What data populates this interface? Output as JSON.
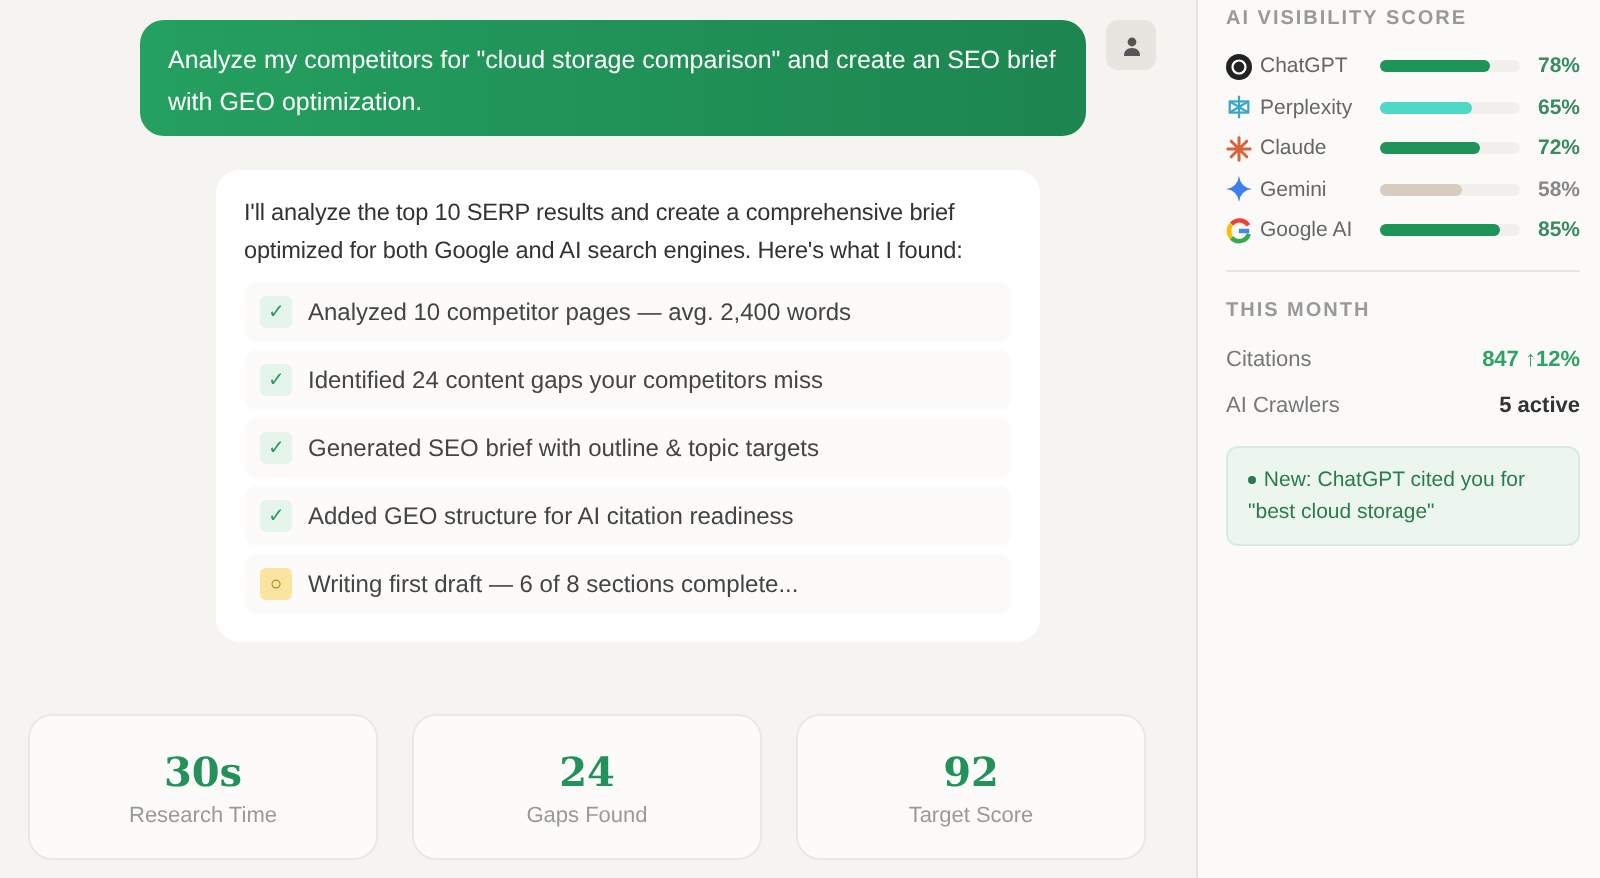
{
  "user_message": {
    "text": "Analyze my competitors for \"cloud storage comparison\" and create an SEO brief with GEO optimization."
  },
  "assistant_message": {
    "intro": "I'll analyze the top 10 SERP results and create a comprehensive brief optimized for both Google and AI search engines. Here's what I found:",
    "steps": [
      {
        "kind": "done",
        "icon": "✓",
        "text": "Analyzed 10 competitor pages — avg. 2,400 words"
      },
      {
        "kind": "done",
        "icon": "✓",
        "text": "Identified 24 content gaps your competitors miss"
      },
      {
        "kind": "done",
        "icon": "✓",
        "text": "Generated SEO brief with outline & topic targets"
      },
      {
        "kind": "done",
        "icon": "✓",
        "text": "Added GEO structure for AI citation readiness"
      },
      {
        "kind": "pending",
        "icon": "○",
        "text": "Writing first draft — 6 of 8 sections complete..."
      }
    ]
  },
  "stats": [
    {
      "value": "30s",
      "label": "Research Time"
    },
    {
      "value": "24",
      "label": "Gaps Found"
    },
    {
      "value": "92",
      "label": "Target Score"
    }
  ],
  "sidebar": {
    "visibility_title": "AI VISIBILITY SCORE",
    "engines": [
      {
        "kind": "chatgpt",
        "name": "ChatGPT",
        "level": 0.78,
        "reading": "78%",
        "color": "#1f9458"
      },
      {
        "kind": "perplexity",
        "name": "Perplexity",
        "level": 0.65,
        "reading": "65%",
        "color": "#4fd8c8"
      },
      {
        "kind": "claude",
        "name": "Claude",
        "level": 0.72,
        "reading": "72%",
        "color": "#1f9458"
      },
      {
        "kind": "gemini",
        "name": "Gemini",
        "level": 0.58,
        "reading": "58%",
        "color": "#d6ccc2"
      },
      {
        "kind": "google",
        "name": "Google AI",
        "level": 0.85,
        "reading": "85%",
        "color": "#1f9458"
      }
    ],
    "month_title": "THIS MONTH",
    "metrics": [
      {
        "kind": "trend",
        "label": "Citations",
        "value": "847 ↑12%"
      },
      {
        "kind": "plain",
        "label": "AI Crawlers",
        "value": "5 active"
      }
    ],
    "notice": {
      "text": "New: ChatGPT cited you for \"best cloud storage\""
    }
  }
}
